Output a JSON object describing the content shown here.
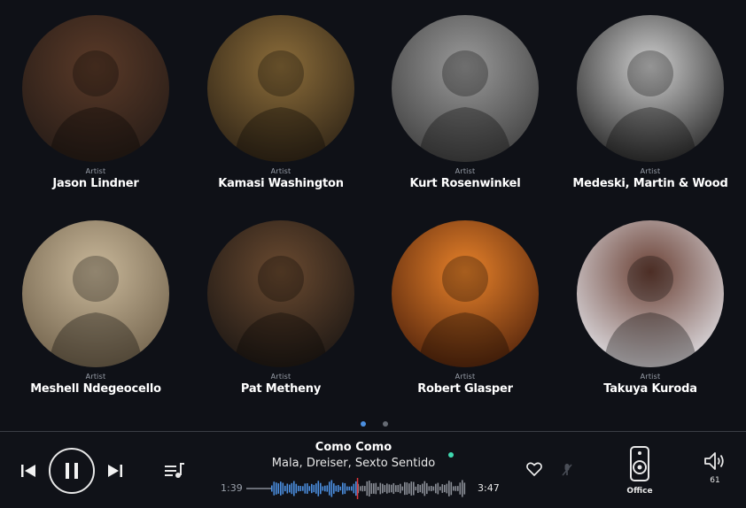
{
  "artists": [
    {
      "type": "Artist",
      "name": "Jason Lindner",
      "photo_colors": [
        "#5a3a28",
        "#231a16"
      ]
    },
    {
      "type": "Artist",
      "name": "Kamasi Washington",
      "photo_colors": [
        "#8c6d3a",
        "#2a2014"
      ]
    },
    {
      "type": "Artist",
      "name": "Kurt Rosenwinkel",
      "photo_colors": [
        "#9a9a9a",
        "#3b3b3b"
      ]
    },
    {
      "type": "Artist",
      "name": "Medeski, Martin & Wood",
      "photo_colors": [
        "#cfcfcf",
        "#1d1d1d"
      ]
    },
    {
      "type": "Artist",
      "name": "Meshell Ndegeocello",
      "photo_colors": [
        "#c9b89a",
        "#6d5e48"
      ]
    },
    {
      "type": "Artist",
      "name": "Pat Metheny",
      "photo_colors": [
        "#6a4a30",
        "#181412"
      ]
    },
    {
      "type": "Artist",
      "name": "Robert Glasper",
      "photo_colors": [
        "#e8822a",
        "#4a1e0a"
      ]
    },
    {
      "type": "Artist",
      "name": "Takuya Kuroda",
      "photo_colors": [
        "#6a4034",
        "#e8eaf0"
      ]
    }
  ],
  "pagination": {
    "pages": 2,
    "current": 1
  },
  "now_playing": {
    "title": "Como Como",
    "artist": "Mala, Dreiser, Sexto Sentido",
    "elapsed": "1:39",
    "total": "3:47",
    "progress": 0.436
  },
  "room": {
    "name": "Office",
    "icon": "speaker-icon"
  },
  "volume": {
    "level": "61",
    "icon": "volume-icon"
  },
  "colors": {
    "accent": "#4b8fe0",
    "playhead": "#e0353a",
    "live": "#3fd9b0",
    "background": "#0f1117"
  }
}
